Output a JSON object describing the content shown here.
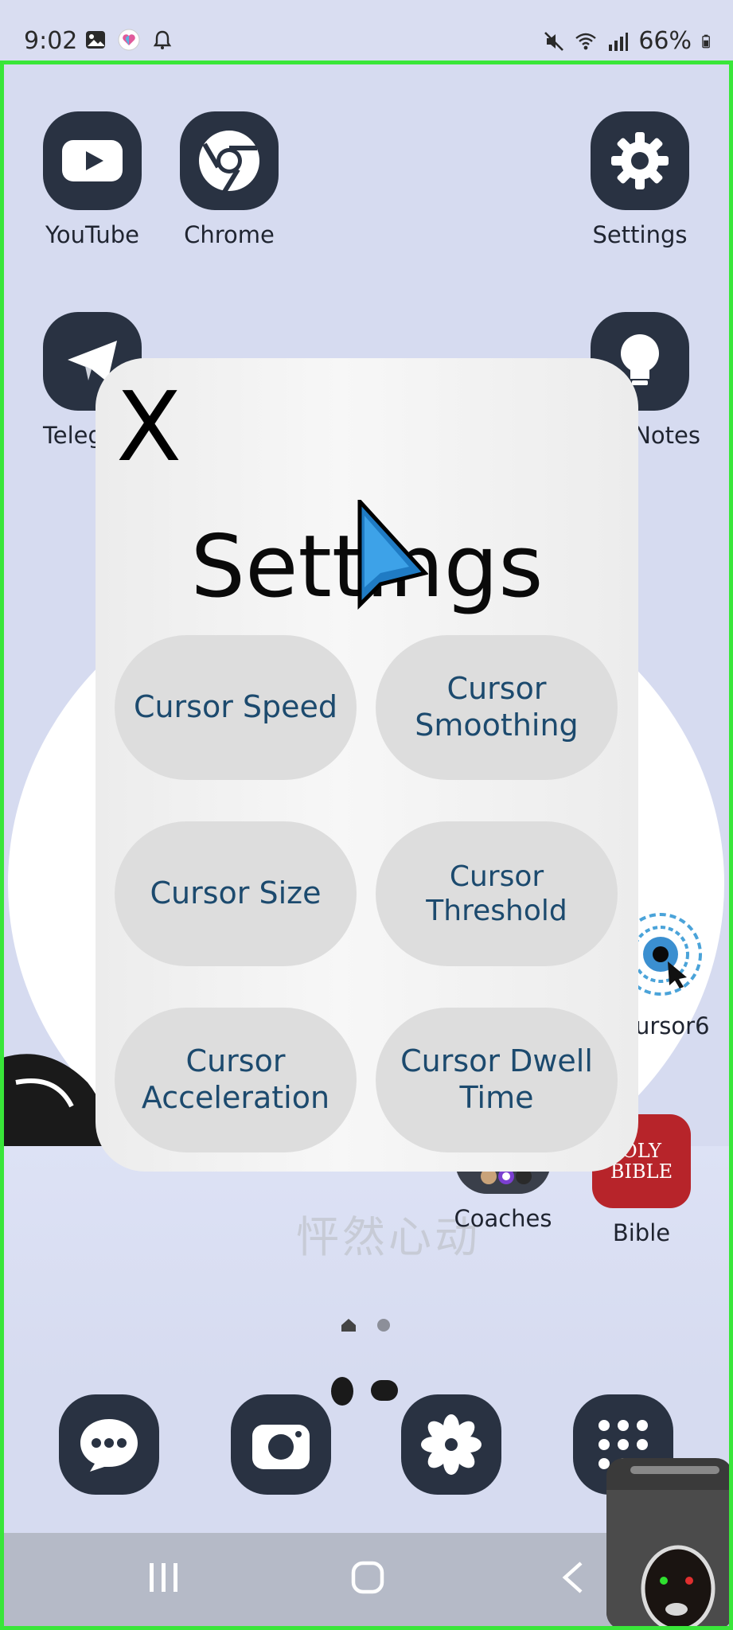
{
  "status_bar": {
    "time": "9:02",
    "battery": "66%",
    "left_icons": [
      "gallery-icon",
      "app-heart-icon",
      "bell-icon"
    ],
    "right_icons": [
      "mute-icon",
      "wifi-icon",
      "signal-icon",
      "battery-icon"
    ]
  },
  "apps": {
    "youtube": "YouTube",
    "chrome": "Chrome",
    "settings": "Settings",
    "telegram": "Teleg",
    "notes": "Notes",
    "cursor6": "ursor6",
    "coaches": "Coaches",
    "bible": "Bible",
    "bible_art": "OLY\nBIBLE"
  },
  "dialog": {
    "close": "X",
    "title": "Settings",
    "options": [
      "Cursor Speed",
      "Cursor\nSmoothing",
      "Cursor Size",
      "Cursor Threshold",
      "Cursor\nAcceleration",
      "Cursor Dwell\nTime"
    ]
  },
  "dock": [
    "messages-icon",
    "camera-icon",
    "flower-icon",
    "apps-grid-icon"
  ],
  "nav": [
    "recents-icon",
    "home-icon",
    "back-icon"
  ],
  "wallpaper_text": "怦然心动"
}
